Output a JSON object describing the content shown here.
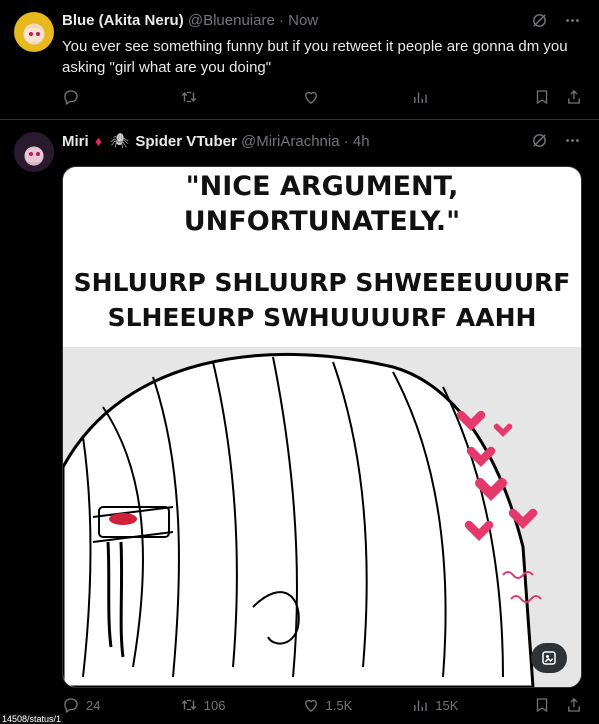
{
  "tweet1": {
    "name": "Blue (Akita Neru)",
    "handle": "@Bluenuiare",
    "separator": "·",
    "time": "Now",
    "text": "You ever see something funny but if you retweet it people are gonna dm you asking \"girl what are you doing\""
  },
  "tweet2": {
    "name": "Miri",
    "name_suffix": "Spider VTuber",
    "handle": "@MiriArachnia",
    "separator": "·",
    "time": "4h",
    "image_caption_line1": "\"NICE ARGUMENT,",
    "image_caption_line2": "UNFORTUNATELY.\"",
    "image_caption_line3": "SHLUURP SHLUURP SHWEEEUUURF",
    "image_caption_line4": "SLHEEURP SWHUUUURF AAHH",
    "replies": "24",
    "retweets": "106",
    "likes": "1.5K",
    "views": "15K"
  },
  "icons": [
    "grok-icon",
    "more-icon",
    "reply-icon",
    "retweet-icon",
    "like-icon",
    "views-icon",
    "bookmark-icon",
    "share-icon",
    "alt-text-icon"
  ],
  "status_bar": "14508/status/1"
}
